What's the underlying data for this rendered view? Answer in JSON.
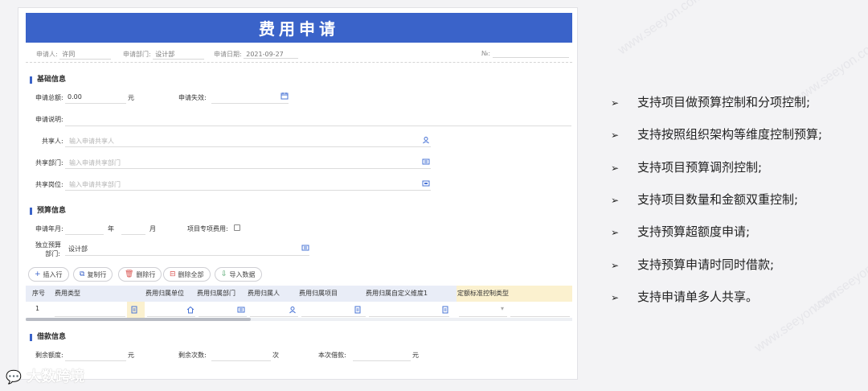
{
  "watermark": "www.seeyon.com",
  "form": {
    "title": "费用申请",
    "header": {
      "applicant_label": "申请人:",
      "applicant_value": "许同",
      "dept_label": "申请部门:",
      "dept_value": "设计部",
      "date_label": "申请日期:",
      "date_value": "2021-09-27",
      "no_label": "№:"
    },
    "basic": {
      "section_title": "基础信息",
      "total_label": "申请总额:",
      "total_value": "0.00",
      "total_unit": "元",
      "expire_label": "申请失效:",
      "desc_label": "申请说明:",
      "sharer_label": "共享人:",
      "sharer_placeholder": "输入申请共享人",
      "share_dept_label": "共享部门:",
      "share_dept_placeholder": "输入申请共享部门",
      "share_post_label": "共享岗位:",
      "share_post_placeholder": "输入申请共享部门"
    },
    "budget": {
      "section_title": "预算信息",
      "year_month_label": "申请年月:",
      "year_unit": "年",
      "month_unit": "月",
      "special_label": "项目专项费用:",
      "independent_dept_label_1": "独立预算",
      "independent_dept_label_2": "部门:",
      "independent_dept_value": "设计部"
    },
    "toolbar": {
      "insert": "插入行",
      "copy": "复制行",
      "delete": "删除行",
      "delete_all": "删除全部",
      "import": "导入数据"
    },
    "table": {
      "columns": [
        "序号",
        "费用类型",
        "费用归属单位",
        "费用归属部门",
        "费用归属人",
        "费用归属项目",
        "费用归属自定义维度1",
        "定额标准控制类型"
      ],
      "rows": [
        {
          "index": "1"
        }
      ]
    },
    "loan": {
      "section_title": "借款信息",
      "remaining_label": "剩余额度:",
      "remaining_unit": "元",
      "times_label": "剩余次数:",
      "times_unit": "次",
      "this_loan_label": "本次借款:",
      "this_loan_unit": "元"
    }
  },
  "features": [
    "支持项目做预算控制和分项控制;",
    "支持按照组织架构等维度控制预算;",
    "支持项目预算调剂控制;",
    "支持项目数量和金额双重控制;",
    "支持预算超额度申请;",
    "支持预算申请时同时借款;",
    "支持申请单多人共享。"
  ],
  "bullet_glyph": "➢",
  "logo_text": "大数跨境",
  "colors": {
    "banner": "#3a63c9",
    "highlight": "#fbf1cf",
    "table_header": "#e9edf7"
  }
}
